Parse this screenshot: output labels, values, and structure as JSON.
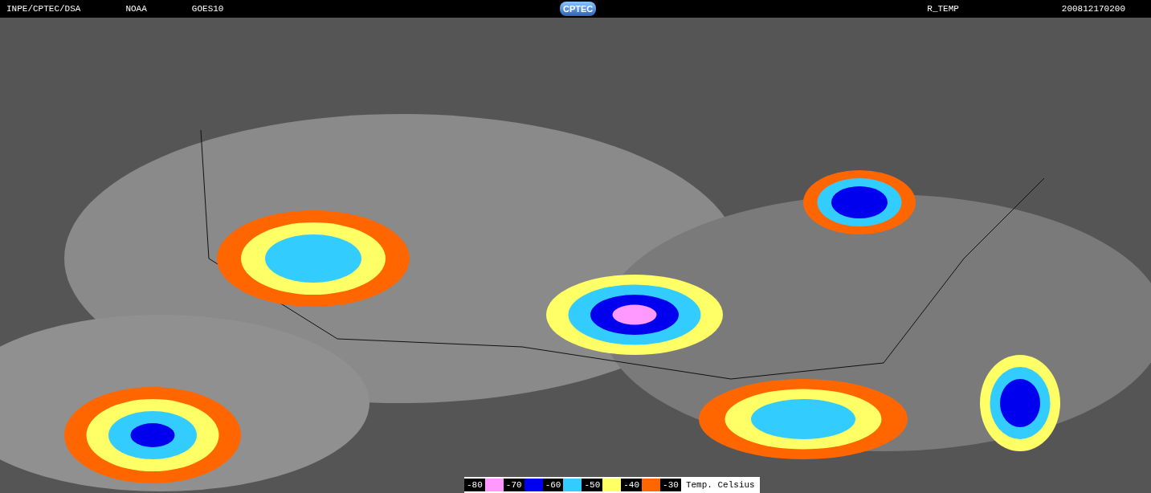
{
  "header": {
    "left": [
      "INPE/CPTEC/DSA",
      "NOAA",
      "GOES10"
    ],
    "logo": "CPTEC",
    "product": "R_TEMP",
    "timestamp": "200812170200"
  },
  "legend": {
    "steps": [
      {
        "label": "-80",
        "color": "#ff99ff"
      },
      {
        "label": "-70",
        "color": "#0000ee"
      },
      {
        "label": "-60",
        "color": "#33ccff"
      },
      {
        "label": "-50",
        "color": "#ffff66"
      },
      {
        "label": "-40",
        "color": "#ff6600"
      },
      {
        "label": "-30"
      }
    ],
    "unit": "Temp. Celsius"
  }
}
